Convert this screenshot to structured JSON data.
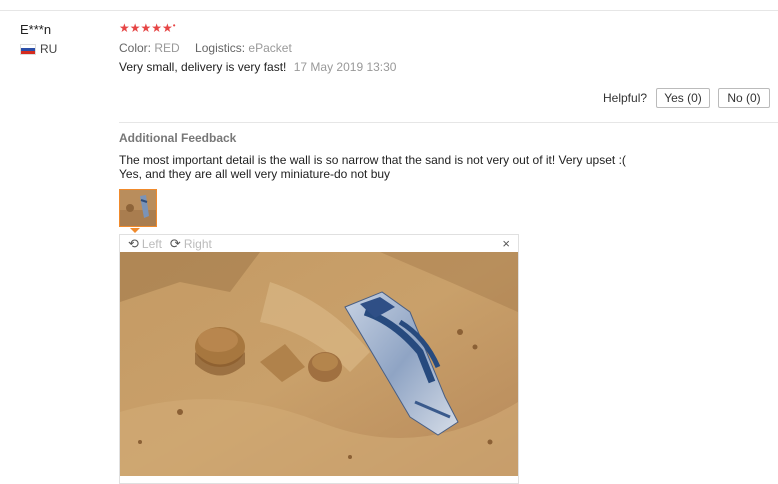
{
  "reviewer": {
    "name": "E***n",
    "country": "RU"
  },
  "rating": {
    "stars": 5,
    "star_glyphs": "★★★★★"
  },
  "attributes": {
    "color_label": "Color:",
    "color_value": "RED",
    "logistics_label": "Logistics:",
    "logistics_value": "ePacket"
  },
  "review": {
    "text": "Very small, delivery is very fast!",
    "date": "17 May 2019 13:30"
  },
  "helpful": {
    "label": "Helpful?",
    "yes": "Yes (0)",
    "no": "No (0)"
  },
  "additional": {
    "title": "Additional Feedback",
    "line1": "The most important detail is the wall is so narrow that the sand is not very out of it! Very upset :(",
    "line2": "Yes, and they are all well very miniature-do not buy"
  },
  "viewer": {
    "rotate_left": "Left",
    "rotate_right": "Right",
    "close": "×"
  },
  "colors": {
    "star": "#e64545",
    "thumb_border": "#f08a2c",
    "sand": "#c9a06a"
  }
}
